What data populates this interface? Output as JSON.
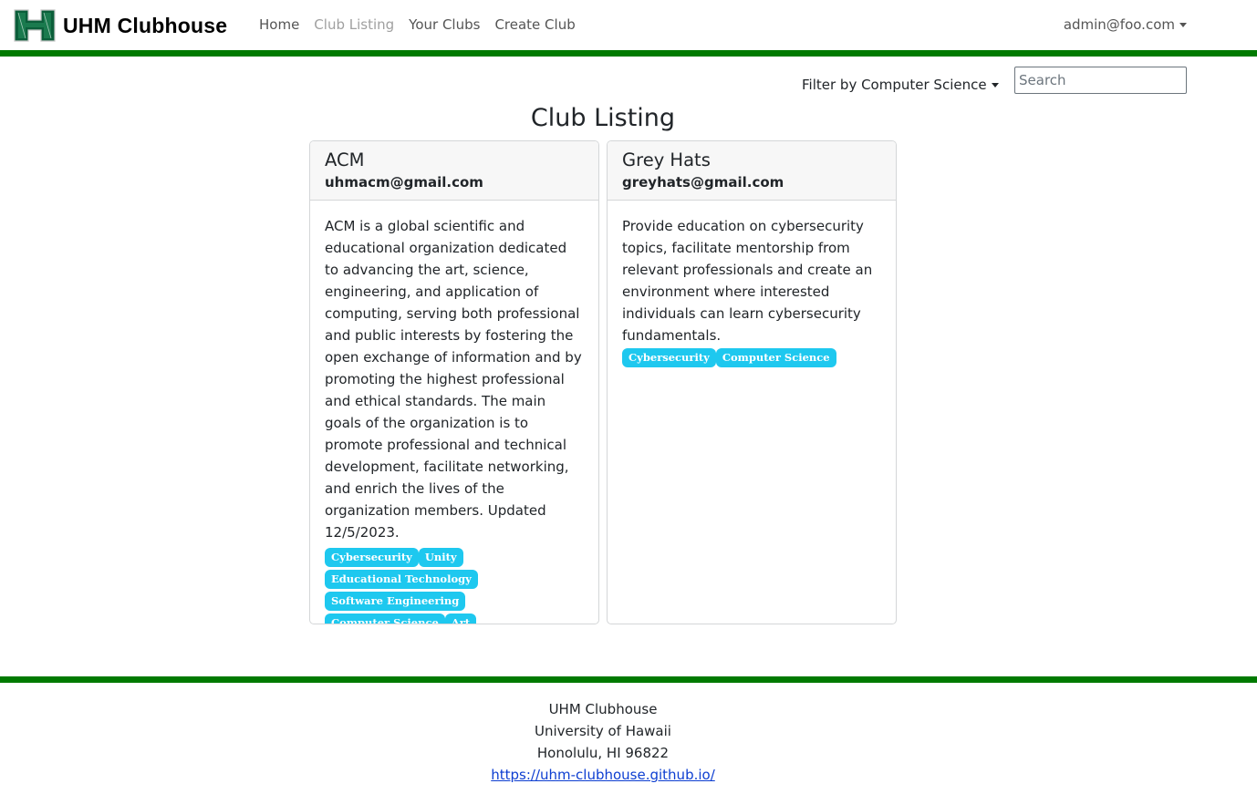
{
  "navbar": {
    "brand_title": "UHM Clubhouse",
    "links": [
      {
        "label": "Home",
        "active": false
      },
      {
        "label": "Club Listing",
        "active": true
      },
      {
        "label": "Your Clubs",
        "active": false
      },
      {
        "label": "Create Club",
        "active": false
      }
    ],
    "user_menu_label": "admin@foo.com",
    "logo_icon": "uh-h-logo-icon"
  },
  "filter": {
    "label": "Filter by Computer Science"
  },
  "search": {
    "placeholder": "Search",
    "value": ""
  },
  "page_title": "Club Listing",
  "clubs": [
    {
      "name": "ACM",
      "email": "uhmacm@gmail.com",
      "description": "ACM is a global scientific and educational organization dedicated to advancing the art, science, engineering, and application of computing, serving both professional and public interests by fostering the open exchange of information and by promoting the highest professional and ethical standards. The main goals of the organization is to promote professional and technical development, facilitate networking, and enrich the lives of the organization members. Updated 12/5/2023.",
      "tags": [
        "Cybersecurity",
        "Unity",
        "Educational Technology",
        "Software Engineering",
        "Computer Science",
        "Art"
      ]
    },
    {
      "name": "Grey Hats",
      "email": "greyhats@gmail.com",
      "description": "Provide education on cybersecurity topics, facilitate mentorship from relevant professionals and create an environment where interested individuals can learn cybersecurity fundamentals.",
      "tags": [
        "Cybersecurity",
        "Computer Science"
      ]
    }
  ],
  "footer": {
    "line1": "UHM Clubhouse",
    "line2": "University of Hawaii",
    "line3": "Honolulu, HI 96822",
    "link": "https://uhm-clubhouse.github.io/"
  },
  "colors": {
    "accent_green": "#007a00",
    "tag_bg": "#1ec8ef",
    "link_blue": "#0d3ed1"
  }
}
